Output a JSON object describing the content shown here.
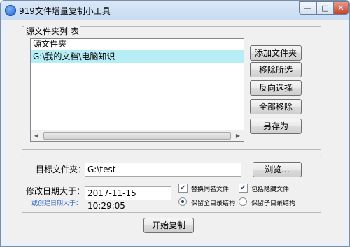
{
  "window": {
    "title": "919文件增量复制小工具",
    "minimize_symbol": "—",
    "maximize_symbol": "□",
    "close_symbol": "✕"
  },
  "source_group": {
    "legend": "源文件夹列 表",
    "list_header": "源文件夹",
    "items": [
      "G:\\我的文档\\电脑知识"
    ],
    "scroll_left": "◀",
    "scroll_right": "▶"
  },
  "side_buttons": {
    "add_folder": "添加文件夹",
    "remove_selected": "移除所选",
    "invert_selection": "反向选择",
    "remove_all": "全部移除",
    "save_as": "另存为"
  },
  "target": {
    "label": "目标文件夹：",
    "value": "G:\\test",
    "browse": "浏览..."
  },
  "date": {
    "label": "修改日期大于：",
    "alt_label": "或创建日期大于：",
    "value": "2017-11-15 10:29:05"
  },
  "options": {
    "replace_same_name": "替换同名文件",
    "replace_same_name_checked": true,
    "include_hidden": "包括隐藏文件",
    "include_hidden_checked": true,
    "check_mark": "✔",
    "keep_full_structure": "保留全目录结构",
    "keep_sub_structure": "保留子目录结构",
    "selected_structure": "keep_full_structure"
  },
  "start_button": "开始复制"
}
